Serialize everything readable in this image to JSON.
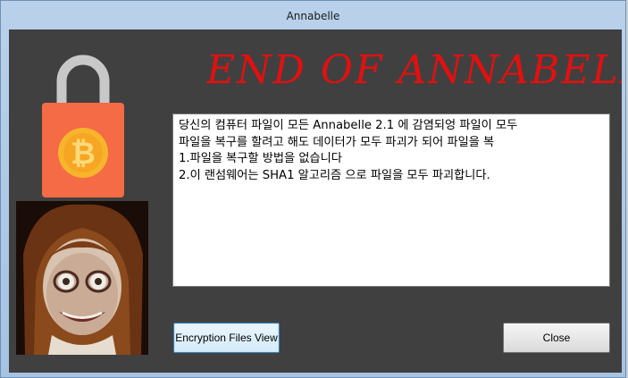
{
  "window": {
    "title": "Annabelle"
  },
  "headline": "END OF ANNABELLE",
  "message_lines": [
    "당신의 컴퓨터 파일이 모든 Annabelle 2.1 에 감염되엉 파일이 모두",
    "파일을 복구를 할려고 해도 데이터가 모두 파괴가 되어 파일을 복",
    "1.파일을 복구할 방법을 없습니다",
    "2.이 랜섬웨어는 SHA1 알고리즘 으로 파일을 모두 파괴합니다."
  ],
  "buttons": {
    "encryption_files_view": "Encryption Files View",
    "close": "Close"
  },
  "colors": {
    "headline": "#e21010",
    "lock_body": "#f46b45",
    "bitcoin_coin": "#f7b52b",
    "client_bg": "#404040"
  },
  "icons": {
    "lock": "bitcoin-padlock-icon",
    "photo": "annabelle-doll-photo"
  }
}
